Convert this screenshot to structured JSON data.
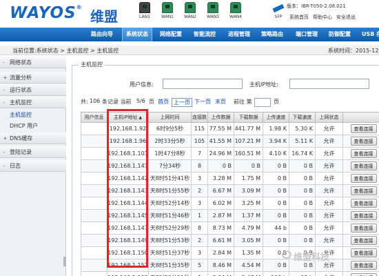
{
  "brand": {
    "logo": "WAYOS",
    "logo_reg": "®",
    "logo_cn": "维盟"
  },
  "ports": [
    {
      "label": "LAN1",
      "state": "off"
    },
    {
      "label": "WAN1",
      "state": "on"
    },
    {
      "label": "WAN2",
      "state": "on"
    },
    {
      "label": "WAN3",
      "state": "on"
    },
    {
      "label": "WAN4",
      "state": "on"
    },
    {
      "label": "SFP",
      "state": "sfp"
    }
  ],
  "version_text": "版本：IBR-T050-2.08.021",
  "top_links": [
    "系统首页",
    "帮助中心",
    "安全退出"
  ],
  "nav": [
    {
      "label": "路由向导",
      "active": false
    },
    {
      "label": "系统状态",
      "active": true
    },
    {
      "label": "网络配置",
      "active": false
    },
    {
      "label": "智能流控",
      "active": false
    },
    {
      "label": "进程管理",
      "active": false
    },
    {
      "label": "策略路由",
      "active": false
    },
    {
      "label": "端口管理",
      "active": false
    },
    {
      "label": "防御配置",
      "active": false
    },
    {
      "label": "USB 存",
      "active": false
    }
  ],
  "location": {
    "text": "当前位置:系统状态 > 主机监控 > 主机监控",
    "time": "系统时间：2015-12-"
  },
  "sidebar": [
    {
      "sym": "-",
      "label": "网络状态"
    },
    {
      "sym": "+",
      "label": "流量分析"
    },
    {
      "sym": "-",
      "label": "运行状态"
    },
    {
      "sym": "-",
      "label": "主机监控"
    },
    {
      "sym": "+",
      "label": "DNS缓存"
    },
    {
      "sym": "-",
      "label": "登陆记录"
    },
    {
      "sym": "-",
      "label": "日志"
    }
  ],
  "sidebar_sub": [
    {
      "label": "主机监控",
      "selected": true
    },
    {
      "label": "DHCP 用户",
      "selected": false
    }
  ],
  "panel": {
    "legend": "主机监控",
    "user_info_label": "用户信息:",
    "user_info_value": "",
    "host_ip_label": "主机IP地址:",
    "host_ip_value": ""
  },
  "pager": {
    "total_prefix": "共:",
    "total": "106",
    "total_suffix": "条记录 当前",
    "page": "5/6",
    "page_suffix": "页",
    "first": "首页",
    "prev": "上一页",
    "next": "下一页",
    "last": "末页",
    "goto_label": "前往 第",
    "goto_suffix": "页"
  },
  "table": {
    "headers": [
      "用户信息",
      "主机IP地址",
      "上网时间",
      "连接数",
      "上传数据",
      "下载数据",
      "上传速度",
      "下载速度",
      "上网状态",
      ""
    ],
    "sort_arrow": "▲",
    "rows": [
      {
        "ip": "192.168.1.92",
        "time": "6时9分5秒",
        "conn": "115",
        "up": "77.55 M",
        "down": "441.77 M",
        "upr": "1.98 K",
        "downr": "5.30 K",
        "status": "允许",
        "action": "查看连接"
      },
      {
        "ip": "192.168.1.96",
        "time": "2时33分5秒",
        "conn": "105",
        "up": "41.55 M",
        "down": "107.21 M",
        "upr": "3.94 K",
        "downr": "5.11 K",
        "status": "允许",
        "action": "查看连接"
      },
      {
        "ip": "192.168.1.101",
        "time": "1时47分8秒",
        "conn": "7",
        "up": "24.96 M",
        "down": "160.51 M",
        "upr": "4.10 K",
        "downr": "16.74 K",
        "status": "允许",
        "action": "查看连接"
      },
      {
        "ip": "192.168.1.141",
        "time": "7分34秒",
        "conn": "8",
        "up": "0 B",
        "down": "0 B",
        "upr": "0 B",
        "downr": "0 B",
        "status": "允许",
        "action": "查看连接"
      },
      {
        "ip": "192.168.1.142",
        "time": "天8时51分41秒",
        "conn": "3",
        "up": "3.28 M",
        "down": "1.75 M",
        "upr": "0 B",
        "downr": "0 B",
        "status": "允许",
        "action": "查看连接"
      },
      {
        "ip": "192.168.1.143",
        "time": "天8时51分55秒",
        "conn": "2",
        "up": "6.67 M",
        "down": "3.09 M",
        "upr": "0 B",
        "downr": "0 B",
        "status": "允许",
        "action": "查看连接"
      },
      {
        "ip": "192.168.1.144",
        "time": "天8时52分14秒",
        "conn": "3",
        "up": "6.02 M",
        "down": "3.25 M",
        "upr": "0 B",
        "downr": "0 B",
        "status": "允许",
        "action": "查看连接"
      },
      {
        "ip": "192.168.1.145",
        "time": "天8时51分46秒",
        "conn": "1",
        "up": "2.87 M",
        "down": "1.37 M",
        "upr": "0 B",
        "downr": "0 B",
        "status": "允许",
        "action": "查看连接"
      },
      {
        "ip": "192.168.1.147",
        "time": "天8时52分29秒",
        "conn": "8",
        "up": "8.73 M",
        "down": "4.79 M",
        "upr": "44 b",
        "downr": "0 B",
        "status": "允许",
        "action": "查看连接"
      },
      {
        "ip": "192.168.1.149",
        "time": "天8时51分53秒",
        "conn": "2",
        "up": "6.61 M",
        "down": "3.05 M",
        "upr": "0 B",
        "downr": "0 B",
        "status": "允许",
        "action": "查看连接"
      },
      {
        "ip": "192.168.1.150",
        "time": "天8时51分37秒",
        "conn": "3",
        "up": "2.84 M",
        "down": "1.35 M",
        "upr": "0 B",
        "downr": "0 B",
        "status": "允许",
        "action": "查看连接"
      },
      {
        "ip": "192.168.1.151",
        "time": "天8时51分35秒",
        "conn": "5",
        "up": "8.46 M",
        "down": "4.54 M",
        "upr": "0 B",
        "downr": "0 B",
        "status": "允许",
        "action": "查看连接"
      },
      {
        "ip": "192.168.1.152",
        "time": "天8时52分11秒",
        "conn": "1",
        "up": "5.30 M",
        "down": "2.47 M",
        "upr": "193 b",
        "downr": "98 b",
        "status": "允许",
        "action": "查看连接"
      }
    ]
  },
  "watermark": "维盟科技"
}
